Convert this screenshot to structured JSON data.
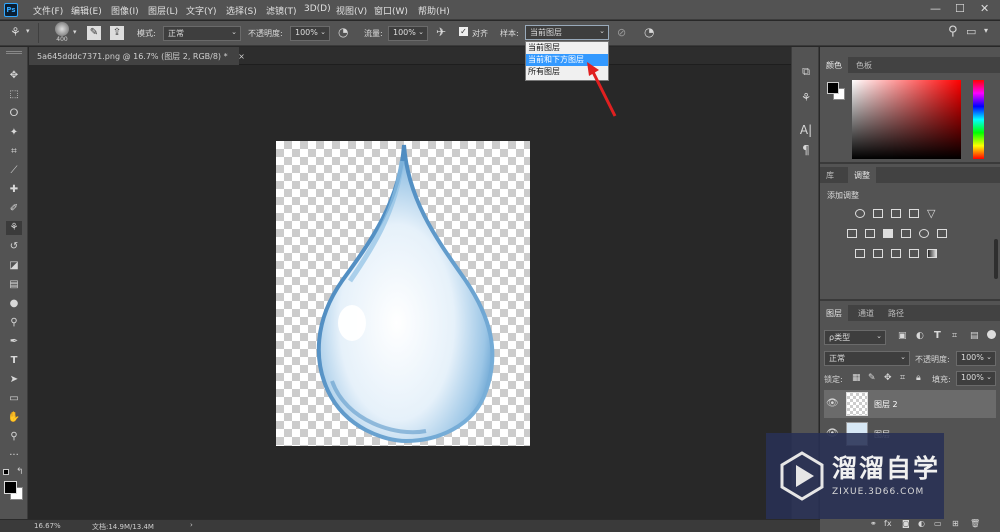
{
  "menubar": {
    "logo": "Ps",
    "items": [
      "文件(F)",
      "编辑(E)",
      "图像(I)",
      "图层(L)",
      "文字(Y)",
      "选择(S)",
      "滤镜(T)",
      "3D(D)",
      "视图(V)",
      "窗口(W)",
      "帮助(H)"
    ],
    "window_controls": [
      "—",
      "☐",
      "✕"
    ]
  },
  "options": {
    "brush_size": "400",
    "mode_label": "模式:",
    "mode_value": "正常",
    "opacity_label": "不透明度:",
    "opacity_value": "100%",
    "flow_label": "流量:",
    "flow_value": "100%",
    "align_label": "对齐",
    "sample_label": "样本:",
    "sample_value": "当前图层"
  },
  "sample_dropdown": {
    "items": [
      "当前图层",
      "当前和下方图层",
      "所有图层"
    ],
    "highlighted_index": 1
  },
  "document": {
    "tab_title": "5a645dddc7371.png @ 16.7% (图层 2, RGB/8) *",
    "tab_close": "×"
  },
  "status": {
    "zoom": "16.67%",
    "doc_info": "文档:14.9M/13.4M",
    "arrow": "›"
  },
  "panels": {
    "color_tabs": [
      "颜色",
      "色板"
    ],
    "adjust_tabs": [
      "库",
      "调整"
    ],
    "adjust_title": "添加调整",
    "layers_tabs": [
      "图层",
      "通道",
      "路径"
    ],
    "kind_label": "ρ类型",
    "blend_mode": "正常",
    "opacity_label": "不透明度:",
    "opacity_value": "100%",
    "lock_label": "锁定:",
    "fill_label": "填充:",
    "fill_value": "100%",
    "layers": [
      {
        "name": "图层 2",
        "visible": true
      },
      {
        "name": "图层",
        "visible": true
      }
    ],
    "bottom_icons": [
      "fx"
    ]
  },
  "watermark": {
    "title": "溜溜自学",
    "url": "ZIXUE.3D66.COM"
  },
  "colors": {
    "ui_bg": "#535353",
    "canvas_bg": "#282828",
    "accent": "#3399ff",
    "annotation": "#e02020",
    "drop": "#7fb4dc"
  }
}
